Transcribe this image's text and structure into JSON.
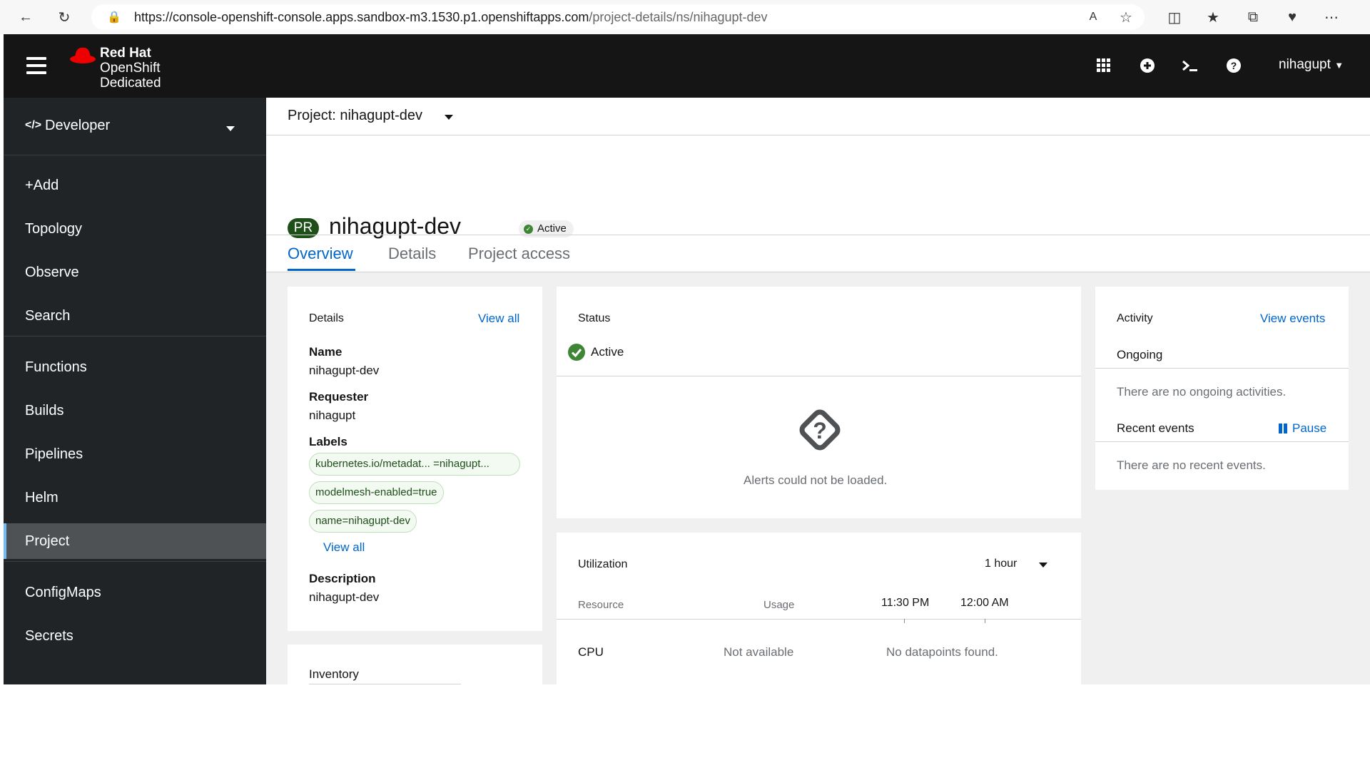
{
  "browser": {
    "url_host": "https://console-openshift-console.apps.sandbox-m3.1530.p1.openshiftapps.com",
    "url_path": "/project-details/ns/nihagupt-dev"
  },
  "masthead": {
    "brand_line1": "Red Hat",
    "brand_line2": "OpenShift",
    "brand_line3": "Dedicated",
    "user": "nihagupt"
  },
  "sidebar": {
    "perspective": "Developer",
    "items": [
      "+Add",
      "Topology",
      "Observe",
      "Search",
      "Functions",
      "Builds",
      "Pipelines",
      "Helm",
      "Project",
      "ConfigMaps",
      "Secrets"
    ],
    "active": "Project"
  },
  "project_bar": {
    "label": "Project: nihagupt-dev"
  },
  "header": {
    "badge": "PR",
    "title": "nihagupt-dev",
    "status": "Active",
    "tabs": [
      "Overview",
      "Details",
      "Project access"
    ]
  },
  "details_card": {
    "title": "Details",
    "view_all": "View all",
    "name_label": "Name",
    "name_value": "nihagupt-dev",
    "requester_label": "Requester",
    "requester_value": "nihagupt",
    "labels_label": "Labels",
    "labels": [
      "kubernetes.io/metadat... =nihagupt...",
      "modelmesh-enabled=true",
      "name=nihagupt-dev"
    ],
    "labels_view_all": "View all",
    "description_label": "Description",
    "description_value": "nihagupt-dev"
  },
  "inventory_card": {
    "title": "Inventory"
  },
  "status_card": {
    "title": "Status",
    "status": "Active",
    "alerts_message": "Alerts could not be loaded."
  },
  "utilization_card": {
    "title": "Utilization",
    "range": "1 hour",
    "col_resource": "Resource",
    "col_usage": "Usage",
    "times": [
      "11:30 PM",
      "12:00 AM"
    ],
    "row_name": "CPU",
    "row_usage": "Not available",
    "row_chart": "No datapoints found."
  },
  "activity_card": {
    "title": "Activity",
    "view_events": "View events",
    "ongoing_label": "Ongoing",
    "ongoing_empty": "There are no ongoing activities.",
    "recent_label": "Recent events",
    "pause": "Pause",
    "recent_empty": "There are no recent events."
  }
}
